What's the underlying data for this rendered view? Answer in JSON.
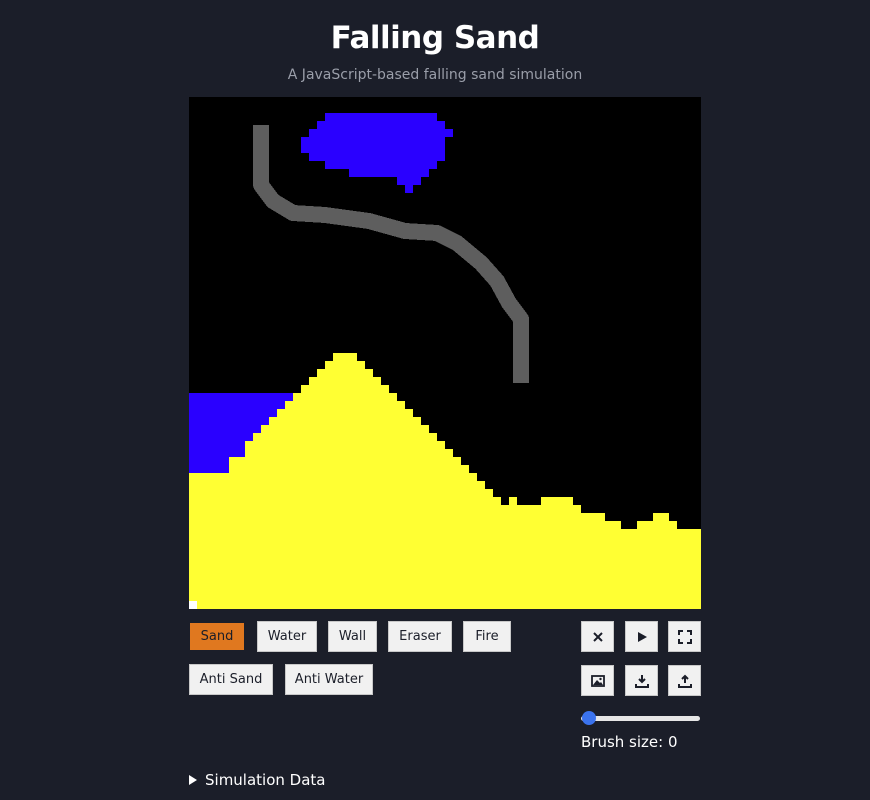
{
  "header": {
    "title": "Falling Sand",
    "subtitle": "A JavaScript-based falling sand simulation"
  },
  "colors": {
    "background": "#1b1e29",
    "canvas_bg": "#000000",
    "sand": "#ffff33",
    "water": "#2a00ff",
    "wall": "#5e5e5e",
    "active_button": "#e0781f",
    "slider": "#3b73ee"
  },
  "materials": [
    {
      "label": "Sand",
      "active": true
    },
    {
      "label": "Water",
      "active": false
    },
    {
      "label": "Wall",
      "active": false
    },
    {
      "label": "Eraser",
      "active": false
    },
    {
      "label": "Fire",
      "active": false
    },
    {
      "label": "Anti Sand",
      "active": false
    },
    {
      "label": "Anti Water",
      "active": false
    }
  ],
  "controls": {
    "icons": [
      "close-icon",
      "play-icon",
      "fullscreen-icon",
      "image-icon",
      "download-icon",
      "upload-icon"
    ],
    "brush_label": "Brush size: 0",
    "brush_size": 0
  },
  "details": {
    "summary": "Simulation Data"
  }
}
